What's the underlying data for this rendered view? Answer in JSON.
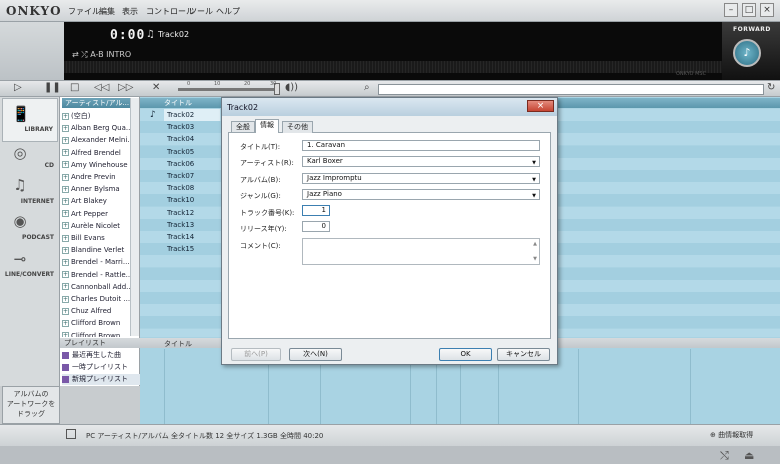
{
  "app": {
    "logo": "ONKYO",
    "menu": [
      "ファイル",
      "編集",
      "表示",
      "コントロール",
      "ツール",
      "ヘルプ"
    ]
  },
  "display": {
    "time": "0:00",
    "track": "Track02",
    "modes": "⇄ ⤮  A-B  INTRO",
    "brand_small": "ONKYO MSC",
    "forward_label": "FORWARD"
  },
  "transport": {
    "ticks": [
      "0",
      "10",
      "20",
      "30"
    ]
  },
  "sources": [
    {
      "label": "LIBRARY",
      "icon": "library-icon"
    },
    {
      "label": "CD",
      "icon": "cd-icon"
    },
    {
      "label": "INTERNET",
      "icon": "internet-icon"
    },
    {
      "label": "PODCAST",
      "icon": "podcast-icon"
    },
    {
      "label": "LINE/CONVERT",
      "icon": "line-convert-icon"
    }
  ],
  "artists": {
    "header": "アーティスト/アル...",
    "items": [
      "(空白)",
      "Alban Berg Qua...",
      "Alexander Melni...",
      "Alfred Brendel",
      "Amy Winehouse",
      "Andre Previn",
      "Anner Bylsma",
      "Art Blakey",
      "Art Pepper",
      "Aurèle Nicolet",
      "Bill Evans",
      "Blandine Verlet",
      "Brendel - Marri...",
      "Brendel - Rattle...",
      "Cannonball Add...",
      "Charles Dutoit ...",
      "Chuz Alfred",
      "Clifford Brown",
      "Clifford Brown..."
    ]
  },
  "tracks": {
    "header": "タイトル",
    "items": [
      "Track02",
      "Track03",
      "Track04",
      "Track05",
      "Track06",
      "Track07",
      "Track08",
      "Track10",
      "Track12",
      "Track13",
      "Track14",
      "Track15"
    ]
  },
  "playlists": {
    "header": "プレイリスト",
    "items": [
      "最近再生した曲",
      "一時プレイリスト",
      "新規プレイリスト"
    ]
  },
  "lower": {
    "header": "タイトル"
  },
  "artwork": {
    "text": [
      "アルバムの",
      "アートワークを",
      "ドラッグ"
    ]
  },
  "status": {
    "text": "PC アーティスト/アルバム  全タイトル数 12  全サイズ 1.3GB  全時間 40:20",
    "info_fetch": "曲情報取得"
  },
  "dialog": {
    "title": "Track02",
    "tabs": [
      "全般",
      "情報",
      "その他"
    ],
    "fields": {
      "title_label": "タイトル(T):",
      "title_value": "1. Caravan",
      "artist_label": "アーティスト(R):",
      "artist_value": "Karl Boxer",
      "album_label": "アルバム(B):",
      "album_value": "Jazz Impromptu",
      "genre_label": "ジャンル(G):",
      "genre_value": "Jazz Piano",
      "track_no_label": "トラック番号(K):",
      "track_no_value": "1",
      "year_label": "リリース年(Y):",
      "year_value": "0",
      "comment_label": "コメント(C):"
    },
    "buttons": {
      "prev": "前へ(P)",
      "next": "次へ(N)",
      "ok": "OK",
      "cancel": "キャンセル"
    }
  }
}
